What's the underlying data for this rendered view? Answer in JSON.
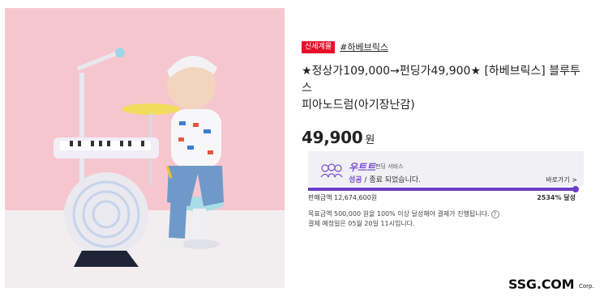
{
  "product": {
    "badge_new": "신세계몰",
    "brand_tag": "#하베브릭스",
    "title_line1": "★정상가109,000→펀딩가49,900★ [하베브릭스] 블루투스",
    "title_line2": "피아노드럼(아기장난감)",
    "price": "49,900",
    "price_unit": "원"
  },
  "funding": {
    "service_logo": "우트트",
    "service_label": "펀딩 서비스",
    "status_ok": "성공",
    "status_rest": " / 종료 되었습니다.",
    "link_label": "바로가기 >",
    "progress_percent": 100,
    "sales_label": "판매금액 12,674,600원",
    "achievement": "2534% 달성",
    "notice_line1": "목표금액 500,000 원을 100% 이상 달성해야 결제가 진행됩니다.",
    "notice_line2": "결제 예정일은 05월 20일 11시입니다.",
    "help_icon": "?"
  },
  "footer": {
    "logo": "SSG.COM",
    "logo_corp": "Corp."
  },
  "colors": {
    "accent_purple": "#6a3fc7",
    "badge_red": "#e6102b",
    "photo_bg": "#f6c6cf"
  }
}
